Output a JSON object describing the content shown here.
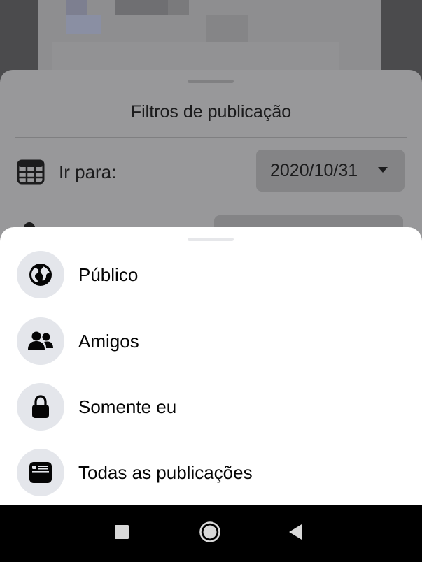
{
  "filter_sheet": {
    "title": "Filtros de publicação",
    "goto_label": "Ir para:",
    "goto_icon": "calendar-icon",
    "date_value": "2020/10/31",
    "date_caret_icon": "caret-down-icon"
  },
  "privacy_sheet": {
    "options": [
      {
        "label": "Público",
        "icon": "globe-icon"
      },
      {
        "label": "Amigos",
        "icon": "friends-icon"
      },
      {
        "label": "Somente eu",
        "icon": "lock-icon"
      },
      {
        "label": "Todas as publicações",
        "icon": "all-posts-icon"
      }
    ]
  },
  "nav_bar": {
    "icons": [
      "recents-icon",
      "home-icon",
      "back-icon"
    ]
  },
  "colors": {
    "sheet_bg": "#ffffff",
    "icon_circle": "#e4e6eb",
    "text": "#050505",
    "dim_overlay": "#98989a"
  }
}
